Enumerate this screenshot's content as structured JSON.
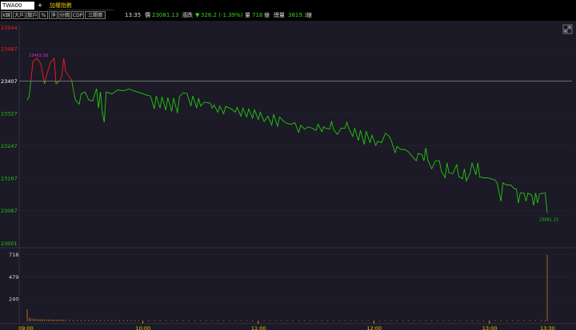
{
  "toolbar": {
    "symbol": "TWA00",
    "search_icon": "+",
    "name": "加權指數",
    "buttons": [
      "K線",
      "大戶",
      "散戶",
      "%",
      "淨",
      "分價",
      "CDP",
      "三關價"
    ],
    "time": "13:35",
    "price_label": "價",
    "price": "23081.13",
    "change_label": "漲跌",
    "change_arrow": "▼",
    "change": "326.2 (-1.39%)",
    "volume_label": "量",
    "volume": "718",
    "volume_unit": "億",
    "total_label": "總量",
    "total": "3819.1",
    "total_unit": "億"
  },
  "colors": {
    "up": "#ff1a1a",
    "down": "#25c70f",
    "flat": "#ffffff",
    "axis": "#e8c800",
    "volume": "#d07a1a",
    "bg": "#1b1a26"
  },
  "expand_icon": "expand-icon",
  "chart_data": {
    "type": "line",
    "reference_price": 23407,
    "y_ticks": [
      "23544",
      "23487",
      "23407",
      "23327",
      "23247",
      "23167",
      "23087",
      "23001"
    ],
    "y_tick_values": [
      23544,
      23487,
      23407,
      23327,
      23247,
      23167,
      23087,
      23001
    ],
    "ylim": [
      23001,
      23544
    ],
    "x_ticks": [
      "09:00",
      "10:00",
      "11:00",
      "12:00",
      "13:00",
      "13:30"
    ],
    "x_tick_minutes": [
      0,
      60,
      120,
      180,
      240,
      270
    ],
    "xlim_minutes": [
      0,
      270
    ],
    "high_label": "23463.38",
    "last_label": "23081.13",
    "price_series": [
      [
        0,
        23360
      ],
      [
        1,
        23368
      ],
      [
        3,
        23455
      ],
      [
        5,
        23463
      ],
      [
        7,
        23450
      ],
      [
        9,
        23400
      ],
      [
        10,
        23420
      ],
      [
        12,
        23452
      ],
      [
        14,
        23463
      ],
      [
        15,
        23400
      ],
      [
        17,
        23408
      ],
      [
        18,
        23420
      ],
      [
        19,
        23463
      ],
      [
        20,
        23430
      ],
      [
        23,
        23410
      ],
      [
        25,
        23360
      ],
      [
        27,
        23350
      ],
      [
        28,
        23375
      ],
      [
        30,
        23380
      ],
      [
        32,
        23360
      ],
      [
        34,
        23358
      ],
      [
        36,
        23388
      ],
      [
        37,
        23340
      ],
      [
        38,
        23380
      ],
      [
        39,
        23330
      ],
      [
        40,
        23305
      ],
      [
        41,
        23380
      ],
      [
        44,
        23375
      ],
      [
        47,
        23385
      ],
      [
        50,
        23383
      ],
      [
        53,
        23387
      ],
      [
        57,
        23380
      ],
      [
        60,
        23376
      ],
      [
        62,
        23372
      ],
      [
        64,
        23370
      ],
      [
        66,
        23338
      ],
      [
        67,
        23370
      ],
      [
        69,
        23340
      ],
      [
        70,
        23368
      ],
      [
        72,
        23335
      ],
      [
        73,
        23366
      ],
      [
        75,
        23332
      ],
      [
        76,
        23365
      ],
      [
        78,
        23328
      ],
      [
        79,
        23368
      ],
      [
        81,
        23378
      ],
      [
        83,
        23376
      ],
      [
        85,
        23345
      ],
      [
        86,
        23370
      ],
      [
        88,
        23340
      ],
      [
        89,
        23365
      ],
      [
        90,
        23345
      ],
      [
        92,
        23355
      ],
      [
        95,
        23352
      ],
      [
        96,
        23340
      ],
      [
        97,
        23348
      ],
      [
        99,
        23330
      ],
      [
        100,
        23345
      ],
      [
        102,
        23326
      ],
      [
        103,
        23344
      ],
      [
        106,
        23338
      ],
      [
        108,
        23330
      ],
      [
        109,
        23342
      ],
      [
        111,
        23320
      ],
      [
        112,
        23340
      ],
      [
        114,
        23318
      ],
      [
        115,
        23338
      ],
      [
        117,
        23315
      ],
      [
        118,
        23336
      ],
      [
        120,
        23312
      ],
      [
        121,
        23330
      ],
      [
        123,
        23307
      ],
      [
        125,
        23320
      ],
      [
        127,
        23298
      ],
      [
        128,
        23325
      ],
      [
        130,
        23294
      ],
      [
        131,
        23318
      ],
      [
        133,
        23308
      ],
      [
        135,
        23302
      ],
      [
        137,
        23300
      ],
      [
        139,
        23304
      ],
      [
        141,
        23280
      ],
      [
        142,
        23298
      ],
      [
        144,
        23288
      ],
      [
        146,
        23294
      ],
      [
        148,
        23290
      ],
      [
        150,
        23285
      ],
      [
        151,
        23300
      ],
      [
        153,
        23282
      ],
      [
        154,
        23294
      ],
      [
        155,
        23290
      ],
      [
        157,
        23288
      ],
      [
        158,
        23308
      ],
      [
        159,
        23288
      ],
      [
        161,
        23275
      ],
      [
        163,
        23290
      ],
      [
        165,
        23290
      ],
      [
        166,
        23305
      ],
      [
        167,
        23290
      ],
      [
        169,
        23270
      ],
      [
        170,
        23290
      ],
      [
        172,
        23260
      ],
      [
        173,
        23285
      ],
      [
        175,
        23250
      ],
      [
        176,
        23283
      ],
      [
        178,
        23255
      ],
      [
        179,
        23273
      ],
      [
        181,
        23248
      ],
      [
        182,
        23258
      ],
      [
        184,
        23255
      ],
      [
        186,
        23278
      ],
      [
        188,
        23270
      ],
      [
        189,
        23260
      ],
      [
        191,
        23230
      ],
      [
        192,
        23245
      ],
      [
        194,
        23238
      ],
      [
        196,
        23238
      ],
      [
        198,
        23232
      ],
      [
        200,
        23220
      ],
      [
        202,
        23210
      ],
      [
        203,
        23228
      ],
      [
        205,
        23225
      ],
      [
        206,
        23210
      ],
      [
        207,
        23242
      ],
      [
        208,
        23212
      ],
      [
        210,
        23190
      ],
      [
        212,
        23210
      ],
      [
        214,
        23210
      ],
      [
        215,
        23185
      ],
      [
        217,
        23168
      ],
      [
        218,
        23205
      ],
      [
        219,
        23180
      ],
      [
        221,
        23178
      ],
      [
        223,
        23200
      ],
      [
        224,
        23172
      ],
      [
        226,
        23165
      ],
      [
        227,
        23190
      ],
      [
        228,
        23160
      ],
      [
        230,
        23180
      ],
      [
        231,
        23205
      ],
      [
        233,
        23175
      ],
      [
        234,
        23205
      ],
      [
        235,
        23170
      ],
      [
        237,
        23168
      ],
      [
        239,
        23168
      ],
      [
        241,
        23165
      ],
      [
        243,
        23162
      ],
      [
        244,
        23155
      ],
      [
        246,
        23110
      ],
      [
        247,
        23155
      ],
      [
        249,
        23150
      ],
      [
        251,
        23150
      ],
      [
        253,
        23140
      ],
      [
        254,
        23140
      ],
      [
        255,
        23105
      ],
      [
        256,
        23130
      ],
      [
        258,
        23130
      ],
      [
        259,
        23110
      ],
      [
        260,
        23130
      ],
      [
        262,
        23125
      ],
      [
        263,
        23100
      ],
      [
        264,
        23130
      ],
      [
        265,
        23105
      ],
      [
        266,
        23128
      ],
      [
        268,
        23130
      ],
      [
        269,
        23130
      ],
      [
        270,
        23081
      ]
    ],
    "volume_ylim": [
      0,
      750
    ],
    "volume_ticks": [
      "718",
      "479",
      "240"
    ],
    "volume_tick_values": [
      718,
      479,
      240
    ],
    "volume_series": [
      [
        0,
        130
      ],
      [
        1,
        40
      ],
      [
        2,
        30
      ],
      [
        3,
        28
      ],
      [
        4,
        25
      ],
      [
        5,
        24
      ],
      [
        6,
        22
      ],
      [
        7,
        22
      ],
      [
        8,
        21
      ],
      [
        9,
        20
      ],
      [
        10,
        20
      ],
      [
        11,
        19
      ],
      [
        12,
        19
      ],
      [
        13,
        18
      ],
      [
        14,
        18
      ],
      [
        15,
        18
      ],
      [
        16,
        17
      ],
      [
        17,
        17
      ],
      [
        18,
        17
      ],
      [
        19,
        16
      ],
      [
        20,
        16
      ],
      [
        22,
        15
      ],
      [
        24,
        15
      ],
      [
        26,
        14
      ],
      [
        28,
        14
      ],
      [
        30,
        14
      ],
      [
        32,
        13
      ],
      [
        34,
        13
      ],
      [
        36,
        13
      ],
      [
        38,
        12
      ],
      [
        40,
        12
      ],
      [
        42,
        12
      ],
      [
        44,
        12
      ],
      [
        46,
        11
      ],
      [
        48,
        11
      ],
      [
        50,
        11
      ],
      [
        52,
        11
      ],
      [
        54,
        11
      ],
      [
        56,
        10
      ],
      [
        58,
        10
      ],
      [
        60,
        10
      ],
      [
        63,
        10
      ],
      [
        66,
        10
      ],
      [
        69,
        10
      ],
      [
        72,
        9
      ],
      [
        75,
        9
      ],
      [
        78,
        9
      ],
      [
        81,
        9
      ],
      [
        84,
        9
      ],
      [
        87,
        9
      ],
      [
        90,
        9
      ],
      [
        93,
        8
      ],
      [
        96,
        8
      ],
      [
        99,
        8
      ],
      [
        102,
        8
      ],
      [
        105,
        8
      ],
      [
        108,
        8
      ],
      [
        111,
        8
      ],
      [
        114,
        8
      ],
      [
        117,
        8
      ],
      [
        120,
        8
      ],
      [
        123,
        8
      ],
      [
        126,
        8
      ],
      [
        129,
        8
      ],
      [
        132,
        8
      ],
      [
        135,
        8
      ],
      [
        138,
        8
      ],
      [
        141,
        8
      ],
      [
        144,
        8
      ],
      [
        147,
        8
      ],
      [
        150,
        8
      ],
      [
        153,
        8
      ],
      [
        156,
        8
      ],
      [
        159,
        8
      ],
      [
        162,
        8
      ],
      [
        165,
        8
      ],
      [
        168,
        8
      ],
      [
        171,
        8
      ],
      [
        174,
        8
      ],
      [
        177,
        8
      ],
      [
        180,
        9
      ],
      [
        183,
        8
      ],
      [
        186,
        8
      ],
      [
        189,
        8
      ],
      [
        192,
        8
      ],
      [
        195,
        8
      ],
      [
        198,
        8
      ],
      [
        201,
        8
      ],
      [
        204,
        8
      ],
      [
        207,
        8
      ],
      [
        210,
        8
      ],
      [
        213,
        8
      ],
      [
        216,
        8
      ],
      [
        219,
        8
      ],
      [
        222,
        8
      ],
      [
        225,
        8
      ],
      [
        228,
        8
      ],
      [
        231,
        8
      ],
      [
        234,
        8
      ],
      [
        237,
        8
      ],
      [
        240,
        9
      ],
      [
        243,
        9
      ],
      [
        246,
        9
      ],
      [
        249,
        9
      ],
      [
        252,
        9
      ],
      [
        255,
        10
      ],
      [
        258,
        10
      ],
      [
        261,
        10
      ],
      [
        264,
        11
      ],
      [
        267,
        12
      ],
      [
        269,
        14
      ],
      [
        270,
        718
      ]
    ]
  }
}
